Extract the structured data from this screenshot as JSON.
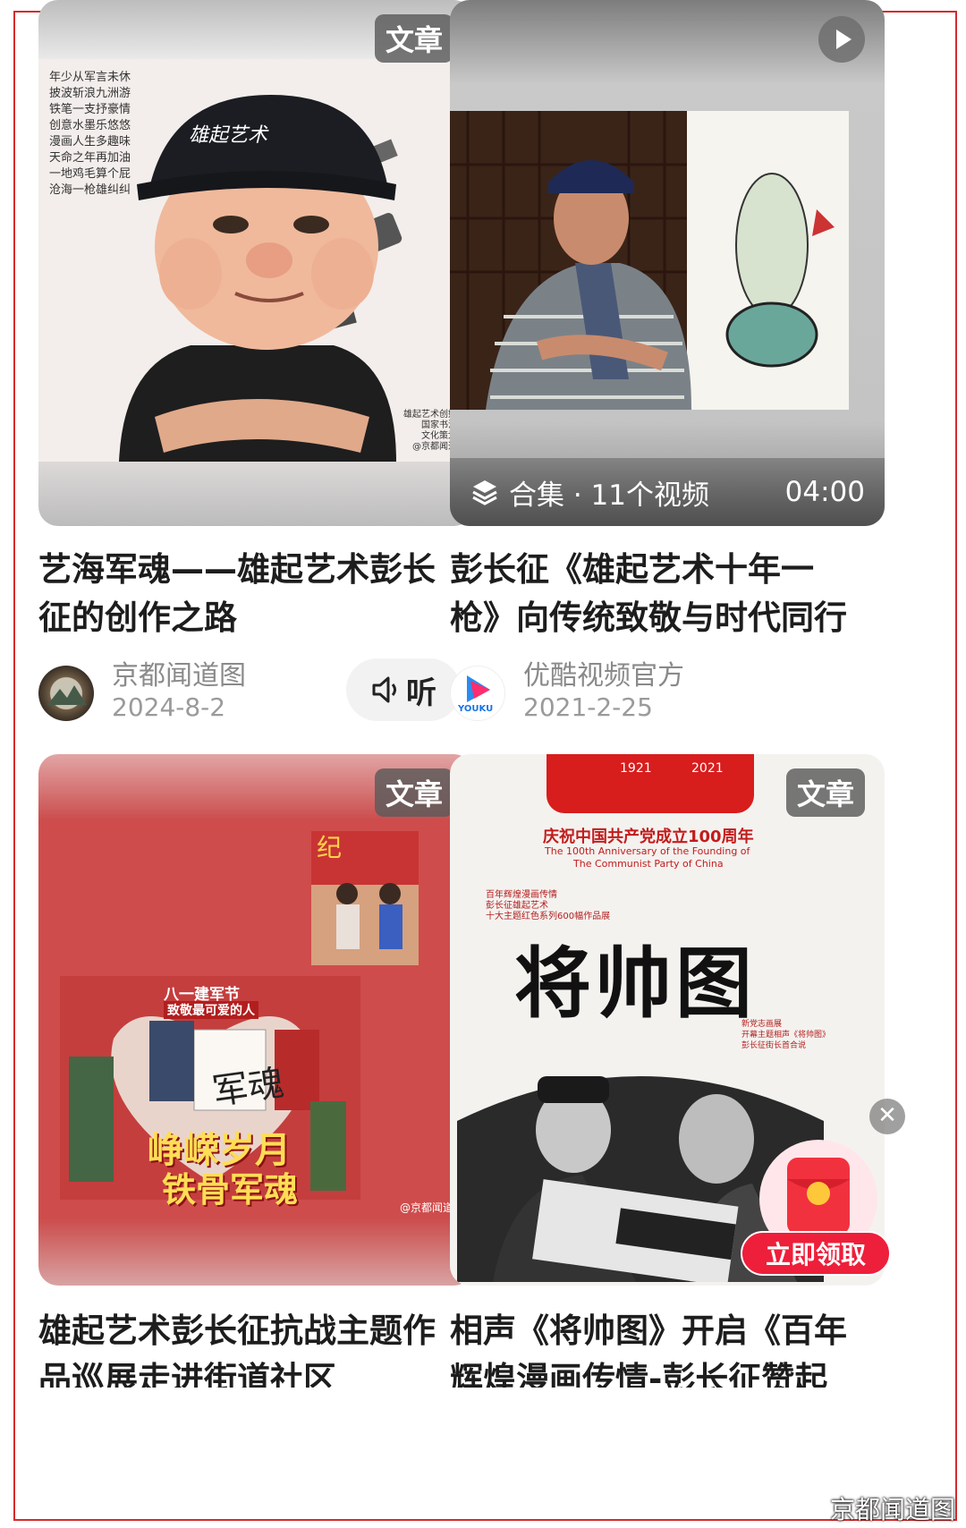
{
  "cards": [
    {
      "badge": "文章",
      "title_line1": "艺海军魂——雄起艺术彭长",
      "title_line2": "征的创作之路",
      "author": "京都闻道图",
      "date": "2024-8-2",
      "listen_label": "听",
      "image_text": {
        "cap": "雄起艺术",
        "poem": [
          "年少从军言未休",
          "披波斩浪九洲游",
          "铁笔一支抒豪情",
          "创意水墨乐悠悠",
          "漫画人生多趣味",
          "天命之年再加油",
          "一地鸡毛算个屁",
          "沧海一枪雄纠纠"
        ],
        "signature": [
          "雄起艺术创始人",
          "国家书法家",
          "文化策划人",
          "@京都闻道图"
        ]
      }
    },
    {
      "title_line1": "彭长征《雄起艺术十年一",
      "title_line2": "枪》向传统致敬与时代同行",
      "author": "优酷视频官方",
      "date": "2021-2-25",
      "collection_label": "合集 · 11个视频",
      "duration": "04:00",
      "avatar_text": "YOUKU"
    },
    {
      "badge": "文章",
      "title_line1": "雄起艺术彭长征抗战主题作",
      "title_line2": "品巡展走进街道社区",
      "image_text": {
        "banner": "八一建军节",
        "banner2": "致敬最可爱的人",
        "slogan1": "峥嵘岁月",
        "slogan2": "铁骨军魂",
        "calligraphy": "军魂",
        "credit": "@京都闻道图"
      }
    },
    {
      "badge": "文章",
      "title_line1": "相声《将帅图》开启《百年",
      "title_line2": "辉煌漫画传情-彭长征赞起",
      "image_text": {
        "years": [
          "1921",
          "2021"
        ],
        "heading": "庆祝中国共产党成立100周年",
        "en1": "The 100th Anniversary of the Founding of",
        "en2": "The Communist Party of China",
        "small1": "百年辉煌漫画传情",
        "small2": "彭长征雄起艺术",
        "small3": "十大主题红色系列600幅作品展",
        "big": "将帅图",
        "right1": "新党志画展",
        "right2": "开幕主题相声《将帅图》",
        "right3": "彭长征街长首合说"
      }
    }
  ],
  "gift_button": "立即领取",
  "watermark": "京都闻道图"
}
